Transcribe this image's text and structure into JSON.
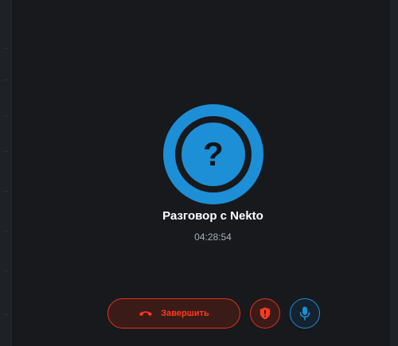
{
  "call": {
    "contact_name": "Разговор с Nekto",
    "duration": "04:28:54",
    "avatar_glyph": "?"
  },
  "controls": {
    "end_call_label": "Завершить",
    "end_call_icon": "phone-hangup-icon",
    "report_icon": "shield-alert-icon",
    "mic_icon": "microphone-icon"
  },
  "colors": {
    "background": "#17191d",
    "accent_blue": "#1d8fd6",
    "danger_red": "#ff3b1f"
  }
}
